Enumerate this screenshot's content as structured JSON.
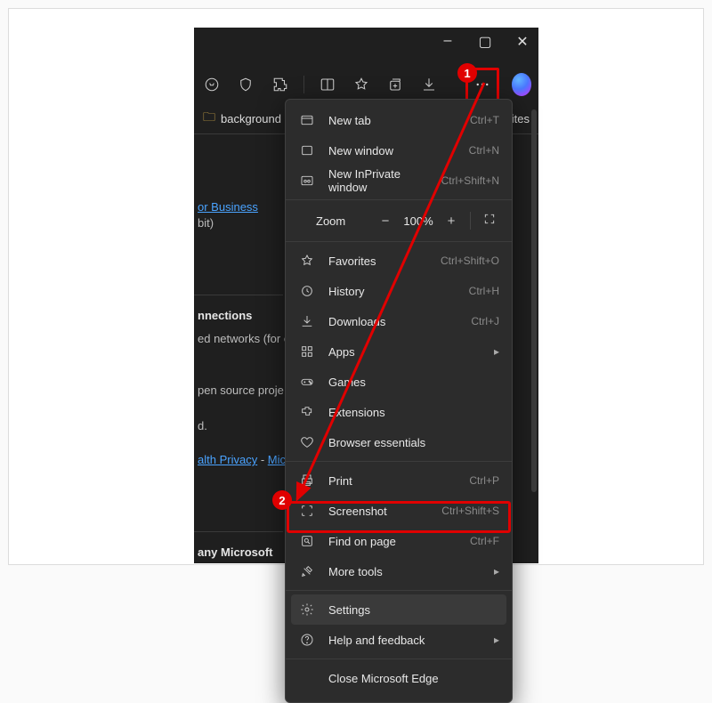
{
  "window": {
    "minimize": "–",
    "maximize": "▢",
    "close": "✕"
  },
  "favorites_bar": {
    "folder_label": "background",
    "other": "orites"
  },
  "bg": {
    "link_business": "or Business",
    "bit": "bit)",
    "connections_hdr": "nnections",
    "networks": "ed networks (for ex",
    "opensource": "pen source proje",
    "d": "d.",
    "privacy_link1": "alth Privacy",
    "privacy_sep": " - ",
    "privacy_link2": "Micro",
    "any_ms": "any Microsoft"
  },
  "menu": {
    "new_tab": {
      "label": "New tab",
      "shortcut": "Ctrl+T"
    },
    "new_window": {
      "label": "New window",
      "shortcut": "Ctrl+N"
    },
    "inprivate": {
      "label": "New InPrivate window",
      "shortcut": "Ctrl+Shift+N"
    },
    "zoom": {
      "label": "Zoom",
      "value": "100%"
    },
    "favorites": {
      "label": "Favorites",
      "shortcut": "Ctrl+Shift+O"
    },
    "history": {
      "label": "History",
      "shortcut": "Ctrl+H"
    },
    "downloads": {
      "label": "Downloads",
      "shortcut": "Ctrl+J"
    },
    "apps": {
      "label": "Apps"
    },
    "games": {
      "label": "Games"
    },
    "extensions": {
      "label": "Extensions"
    },
    "essentials": {
      "label": "Browser essentials"
    },
    "print": {
      "label": "Print",
      "shortcut": "Ctrl+P"
    },
    "screenshot": {
      "label": "Screenshot",
      "shortcut": "Ctrl+Shift+S"
    },
    "find": {
      "label": "Find on page",
      "shortcut": "Ctrl+F"
    },
    "more_tools": {
      "label": "More tools"
    },
    "settings": {
      "label": "Settings"
    },
    "help": {
      "label": "Help and feedback"
    },
    "close_edge": {
      "label": "Close Microsoft Edge"
    }
  },
  "annotations": {
    "b1": "1",
    "b2": "2"
  }
}
